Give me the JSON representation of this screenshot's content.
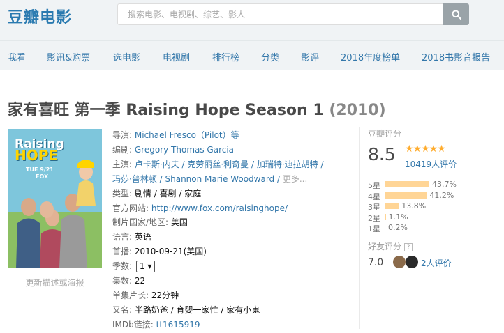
{
  "brand": {
    "logo": "豆瓣电影"
  },
  "search": {
    "placeholder": "搜索电影、电视剧、综艺、影人"
  },
  "nav": [
    "我看",
    "影讯&购票",
    "选电影",
    "电视剧",
    "排行榜",
    "分类",
    "影评",
    "2018年度榜单",
    "2018书影音报告"
  ],
  "title": {
    "name": "家有喜旺 第一季 Raising Hope Season 1",
    "year": "(2010)"
  },
  "poster": {
    "show_title_line1": "Raising",
    "show_title_line2": "HOPE",
    "airtime": "TUE 9/21",
    "network": "FOX",
    "caption": "更新描述或海报"
  },
  "info": {
    "director_label": "导演",
    "director": "Michael Fresco（Pilot）等",
    "writer_label": "编剧",
    "writer": "Gregory Thomas Garcia",
    "cast_label": "主演",
    "cast_line1": "卢卡斯·内夫 / 克劳丽丝·利奇曼 / 加瑞特·迪拉胡特 /",
    "cast_line2_a": "玛莎·普林顿 / Shannon Marie Woodward / ",
    "cast_more": "更多...",
    "genre_label": "类型",
    "genre": "剧情 / 喜剧 / 家庭",
    "website_label": "官方网站",
    "website": "http://www.fox.com/raisinghope/",
    "country_label": "制片国家/地区",
    "country": "美国",
    "language_label": "语言",
    "language": "英语",
    "premiere_label": "首播",
    "premiere": "2010-09-21(美国)",
    "season_label": "季数",
    "season": "1 ▾",
    "episodes_label": "集数",
    "episodes": "22",
    "runtime_label": "单集片长",
    "runtime": "22分钟",
    "aka_label": "又名",
    "aka": "半路奶爸 / 育婴一家忙 / 家有小鬼",
    "imdb_label": "IMDb链接",
    "imdb": "tt1615919"
  },
  "rating": {
    "title": "豆瓣评分",
    "score": "8.5",
    "stars": "★★★★★",
    "votes": "10419人评价",
    "distribution": [
      {
        "label": "5星",
        "percent": 43.7,
        "text": "43.7%"
      },
      {
        "label": "4星",
        "percent": 41.2,
        "text": "41.2%"
      },
      {
        "label": "3星",
        "percent": 13.8,
        "text": "13.8%"
      },
      {
        "label": "2星",
        "percent": 1.1,
        "text": "1.1%"
      },
      {
        "label": "1星",
        "percent": 0.2,
        "text": "0.2%"
      }
    ],
    "friend_title": "好友评分",
    "friend_score": "7.0",
    "friend_votes": "2人评价"
  },
  "colors": {
    "link": "#3377aa",
    "star": "#ffac2d",
    "bar": "#ffd596",
    "header_bg": "#f0f3f5"
  }
}
